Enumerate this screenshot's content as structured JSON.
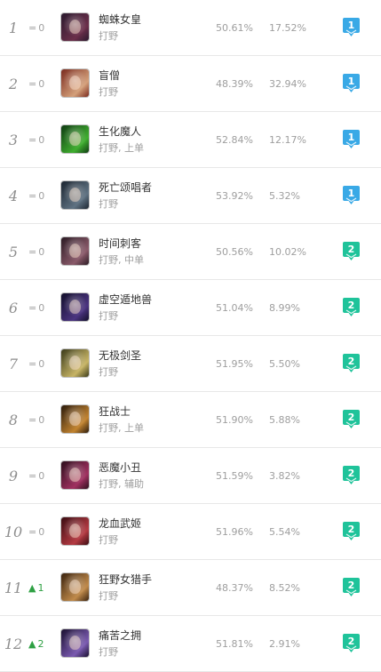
{
  "colors": {
    "tier1": "#39a9e6",
    "tier2": "#1fc39a",
    "trend_up": "#2ea043",
    "trend_same": "#a0a0a0"
  },
  "rows": [
    {
      "rank": "1",
      "trend_symbol": "=",
      "trend_value": "0",
      "trend_dir": "same",
      "name": "蜘蛛女皇",
      "roles": "打野",
      "winrate": "50.61%",
      "pickrate": "17.52%",
      "tier": "1",
      "avatar_colors": [
        "#2a1a2e",
        "#6b2f4a"
      ]
    },
    {
      "rank": "2",
      "trend_symbol": "=",
      "trend_value": "0",
      "trend_dir": "same",
      "name": "盲僧",
      "roles": "打野",
      "winrate": "48.39%",
      "pickrate": "32.94%",
      "tier": "1",
      "avatar_colors": [
        "#7a2a1e",
        "#d4a07a"
      ]
    },
    {
      "rank": "3",
      "trend_symbol": "=",
      "trend_value": "0",
      "trend_dir": "same",
      "name": "生化魔人",
      "roles": "打野, 上单",
      "winrate": "52.84%",
      "pickrate": "12.17%",
      "tier": "1",
      "avatar_colors": [
        "#0f3a12",
        "#3fae2f"
      ]
    },
    {
      "rank": "4",
      "trend_symbol": "=",
      "trend_value": "0",
      "trend_dir": "same",
      "name": "死亡颂唱者",
      "roles": "打野",
      "winrate": "53.92%",
      "pickrate": "5.32%",
      "tier": "1",
      "avatar_colors": [
        "#1c2530",
        "#5f7282"
      ]
    },
    {
      "rank": "5",
      "trend_symbol": "=",
      "trend_value": "0",
      "trend_dir": "same",
      "name": "时间刺客",
      "roles": "打野, 中单",
      "winrate": "50.56%",
      "pickrate": "10.02%",
      "tier": "2",
      "avatar_colors": [
        "#2b1b24",
        "#8a5a6a"
      ]
    },
    {
      "rank": "6",
      "trend_symbol": "=",
      "trend_value": "0",
      "trend_dir": "same",
      "name": "虚空遁地兽",
      "roles": "打野",
      "winrate": "51.04%",
      "pickrate": "8.99%",
      "tier": "2",
      "avatar_colors": [
        "#120f2a",
        "#4b3480"
      ]
    },
    {
      "rank": "7",
      "trend_symbol": "=",
      "trend_value": "0",
      "trend_dir": "same",
      "name": "无极剑圣",
      "roles": "打野",
      "winrate": "51.95%",
      "pickrate": "5.50%",
      "tier": "2",
      "avatar_colors": [
        "#3a3a1a",
        "#c7b465"
      ]
    },
    {
      "rank": "8",
      "trend_symbol": "=",
      "trend_value": "0",
      "trend_dir": "same",
      "name": "狂战士",
      "roles": "打野, 上单",
      "winrate": "51.90%",
      "pickrate": "5.88%",
      "tier": "2",
      "avatar_colors": [
        "#2a1a0c",
        "#c2832f"
      ]
    },
    {
      "rank": "9",
      "trend_symbol": "=",
      "trend_value": "0",
      "trend_dir": "same",
      "name": "恶魔小丑",
      "roles": "打野, 辅助",
      "winrate": "51.59%",
      "pickrate": "3.82%",
      "tier": "2",
      "avatar_colors": [
        "#2c0f1c",
        "#a03060"
      ]
    },
    {
      "rank": "10",
      "trend_symbol": "=",
      "trend_value": "0",
      "trend_dir": "same",
      "name": "龙血武姬",
      "roles": "打野",
      "winrate": "51.96%",
      "pickrate": "5.54%",
      "tier": "2",
      "avatar_colors": [
        "#3a0c12",
        "#b43a42"
      ]
    },
    {
      "rank": "11",
      "trend_symbol": "▲",
      "trend_value": "1",
      "trend_dir": "up",
      "name": "狂野女猎手",
      "roles": "打野",
      "winrate": "48.37%",
      "pickrate": "8.52%",
      "tier": "2",
      "avatar_colors": [
        "#3a220e",
        "#c08a4a"
      ]
    },
    {
      "rank": "12",
      "trend_symbol": "▲",
      "trend_value": "2",
      "trend_dir": "up",
      "name": "痛苦之拥",
      "roles": "打野",
      "winrate": "51.81%",
      "pickrate": "2.91%",
      "tier": "2",
      "avatar_colors": [
        "#1a1030",
        "#7a5ab0"
      ]
    }
  ]
}
